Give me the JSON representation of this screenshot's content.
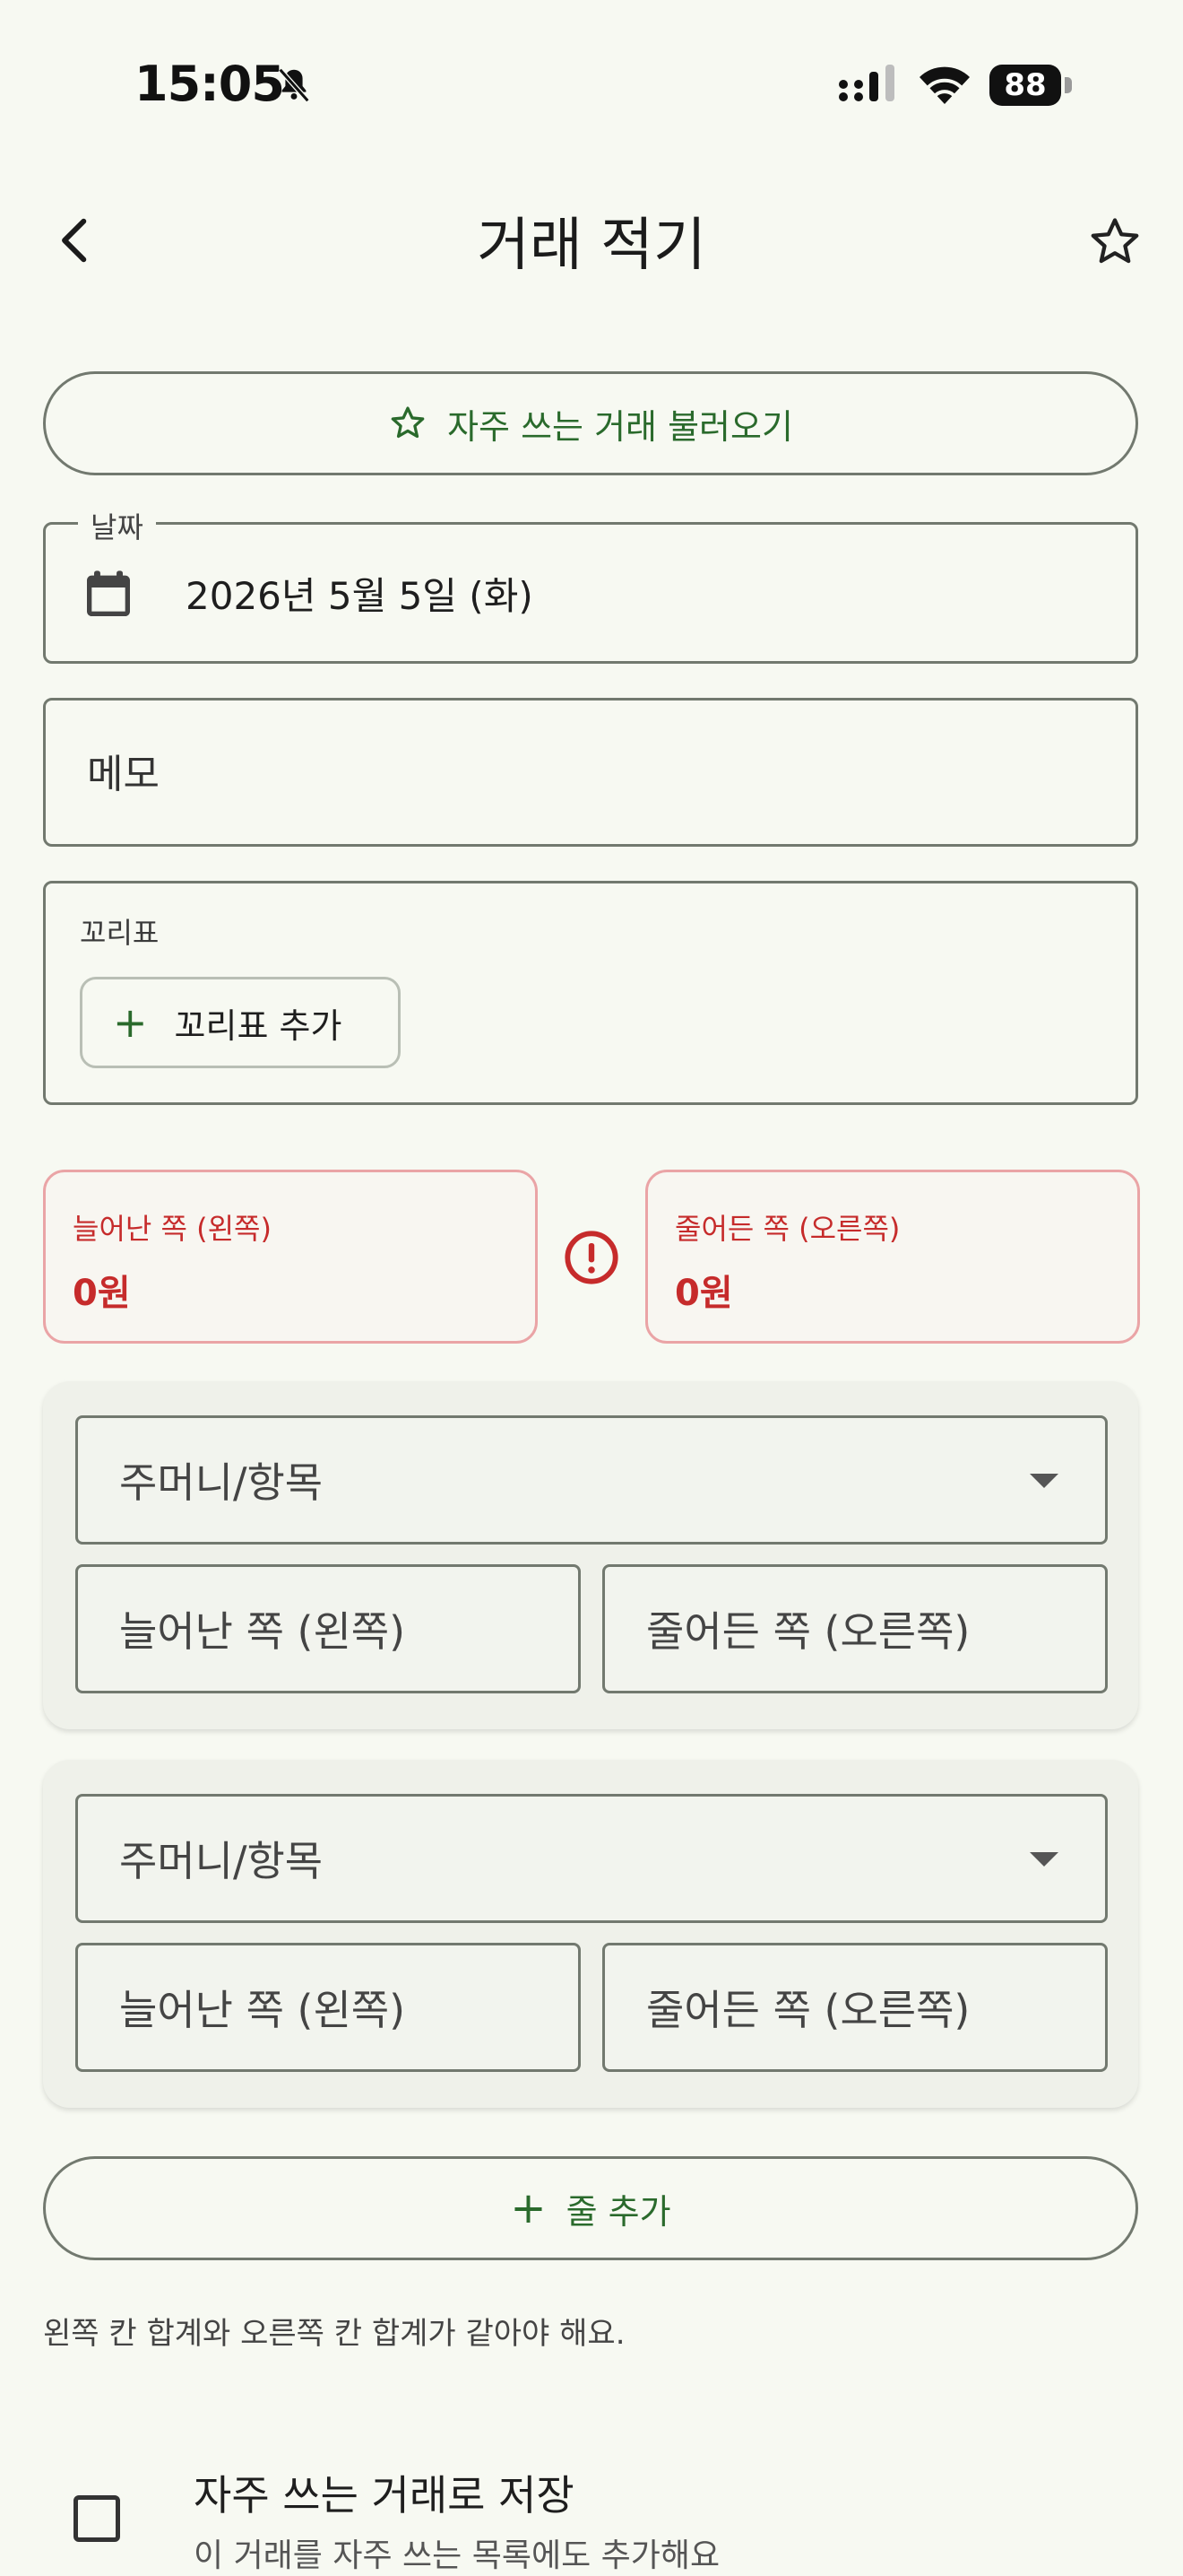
{
  "status_bar": {
    "time": "15:05",
    "battery": "88",
    "icons": [
      "bell-off-icon",
      "signal-icon",
      "wifi-icon",
      "battery-icon"
    ]
  },
  "app_bar": {
    "title": "거래 적기",
    "back_icon": "chevron-left-icon",
    "favorite_icon": "star-outline-icon"
  },
  "load_favorite_button": {
    "label": "자주 쓰는 거래 불러오기",
    "icon": "star-outline-icon"
  },
  "date_field": {
    "label": "날짜",
    "value": "2026년 5월 5일 (화)",
    "icon": "calendar-icon"
  },
  "memo_field": {
    "placeholder": "메모"
  },
  "tags": {
    "label": "꼬리표",
    "add_label": "꼬리표 추가"
  },
  "balance": {
    "left_label": "늘어난 쪽 (왼쪽)",
    "left_value": "0원",
    "right_label": "줄어든 쪽 (오른쪽)",
    "right_value": "0원",
    "status_icon": "error-icon",
    "error_color": "#c62b2b"
  },
  "entries": [
    {
      "account_placeholder": "주머니/항목",
      "left_placeholder": "늘어난 쪽 (왼쪽)",
      "right_placeholder": "줄어든 쪽 (오른쪽)"
    },
    {
      "account_placeholder": "주머니/항목",
      "left_placeholder": "늘어난 쪽 (왼쪽)",
      "right_placeholder": "줄어든 쪽 (오른쪽)"
    }
  ],
  "add_line_button": {
    "label": "줄 추가"
  },
  "hint": "왼쪽 칸 합계와 오른쪽 칸 합계가 같아야 해요.",
  "save_favorite": {
    "checked": false,
    "title": "자주 쓰는 거래로 저장",
    "subtitle": "이 거래를 자주 쓰는 목록에도 추가해요"
  },
  "colors": {
    "accent": "#2a6a2c",
    "background": "#f7f9f2",
    "outline": "#72796f"
  }
}
